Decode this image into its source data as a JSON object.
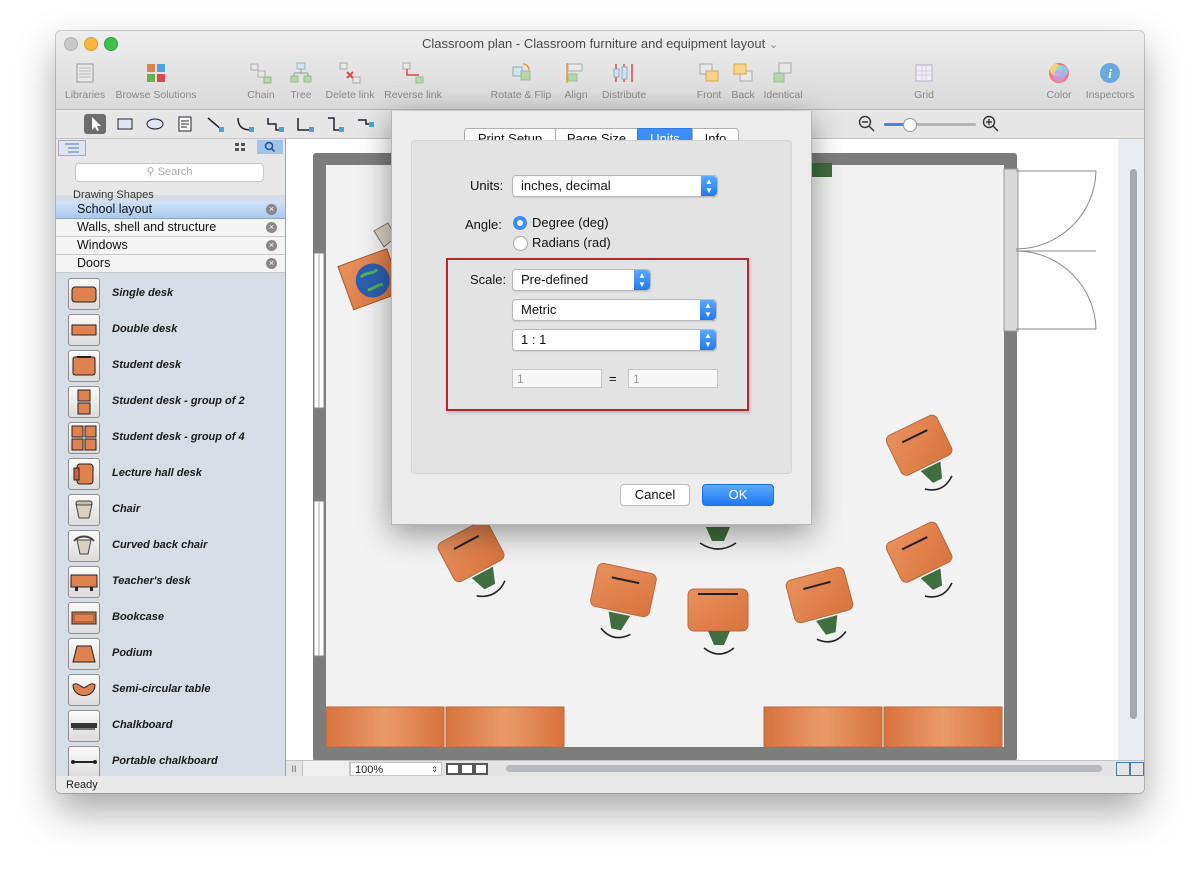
{
  "window": {
    "title": "Classroom plan - Classroom furniture and equipment layout",
    "title_chevron": "⌄"
  },
  "toolbar": {
    "items": [
      {
        "label": "Libraries",
        "icon": "libraries-icon"
      },
      {
        "label": "Browse Solutions",
        "icon": "browse-solutions-icon"
      },
      {
        "label": "Chain",
        "icon": "chain-icon"
      },
      {
        "label": "Tree",
        "icon": "tree-icon"
      },
      {
        "label": "Delete link",
        "icon": "delete-link-icon"
      },
      {
        "label": "Reverse link",
        "icon": "reverse-link-icon"
      },
      {
        "label": "Rotate & Flip",
        "icon": "rotate-flip-icon"
      },
      {
        "label": "Align",
        "icon": "align-icon"
      },
      {
        "label": "Distribute",
        "icon": "distribute-icon"
      },
      {
        "label": "Front",
        "icon": "front-icon"
      },
      {
        "label": "Back",
        "icon": "back-icon"
      },
      {
        "label": "Identical",
        "icon": "identical-icon"
      },
      {
        "label": "Grid",
        "icon": "grid-icon"
      },
      {
        "label": "Color",
        "icon": "color-icon"
      },
      {
        "label": "Inspectors",
        "icon": "inspectors-icon"
      }
    ]
  },
  "sidebar": {
    "search_placeholder": "Search",
    "section_title": "Drawing Shapes",
    "libraries": [
      {
        "label": "School layout",
        "selected": true
      },
      {
        "label": "Walls, shell and structure",
        "selected": false
      },
      {
        "label": "Windows",
        "selected": false
      },
      {
        "label": "Doors",
        "selected": false
      }
    ],
    "shapes": [
      {
        "label": "Single desk"
      },
      {
        "label": "Double desk"
      },
      {
        "label": "Student desk"
      },
      {
        "label": "Student desk - group of 2"
      },
      {
        "label": "Student desk - group of 4"
      },
      {
        "label": "Lecture hall desk"
      },
      {
        "label": "Chair"
      },
      {
        "label": "Curved back chair"
      },
      {
        "label": "Teacher's desk"
      },
      {
        "label": "Bookcase"
      },
      {
        "label": "Podium"
      },
      {
        "label": "Semi-circular table"
      },
      {
        "label": "Chalkboard"
      },
      {
        "label": "Portable chalkboard"
      }
    ]
  },
  "bottom": {
    "zoom_value": "100%"
  },
  "status": {
    "text": "Ready"
  },
  "dialog": {
    "tabs": [
      {
        "label": "Print Setup",
        "active": false
      },
      {
        "label": "Page Size",
        "active": false
      },
      {
        "label": "Units",
        "active": true
      },
      {
        "label": "Info",
        "active": false
      }
    ],
    "units_label": "Units:",
    "units_value": "inches, decimal",
    "angle_label": "Angle:",
    "angle_options": [
      {
        "label": "Degree (deg)",
        "checked": true
      },
      {
        "label": "Radians (rad)",
        "checked": false
      }
    ],
    "scale_label": "Scale:",
    "scale_value": "Pre-defined",
    "system_value": "Metric",
    "ratio_value": "1 : 1",
    "field_left": "1",
    "equals": "=",
    "field_right": "1",
    "cancel_label": "Cancel",
    "ok_label": "OK"
  },
  "colors": {
    "accent": "#1e78f0",
    "desk": "#e0824f",
    "chair": "#3f6e3f",
    "wall": "#7a7a7a",
    "highlight_box": "#b0282d"
  }
}
